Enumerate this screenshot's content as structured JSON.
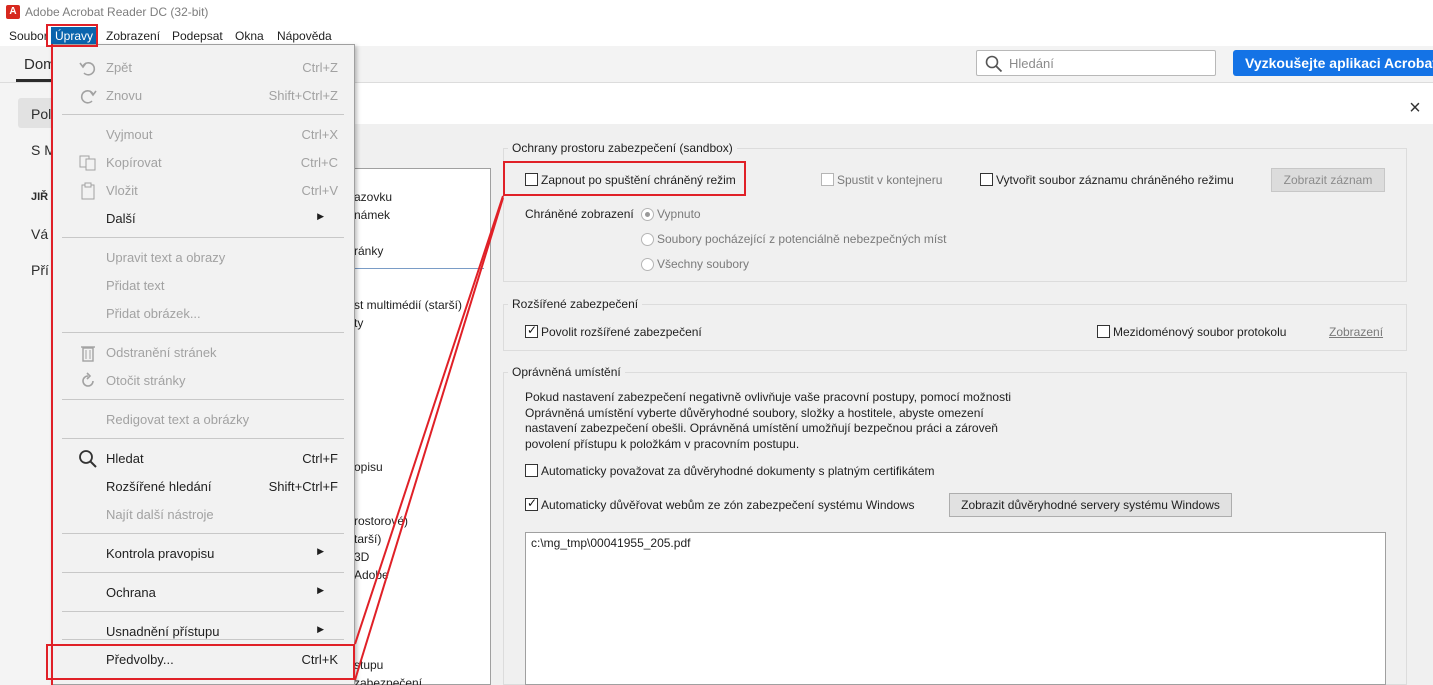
{
  "window": {
    "title": "Adobe Acrobat Reader DC (32-bit)",
    "logo": "A"
  },
  "menubar": {
    "items": [
      "Soubor",
      "Úpravy",
      "Zobrazení",
      "Podepsat",
      "Okna",
      "Nápověda"
    ],
    "active": "Úpravy"
  },
  "toolbar": {
    "tab_label": "Dom",
    "search_placeholder": "Hledání",
    "try_button": "Vyzkoušejte aplikaci Acrobat"
  },
  "left_panel": {
    "items": [
      "Pol",
      "S M",
      "JIŘ",
      "Vá",
      "Pří"
    ]
  },
  "categories_partial": [
    "azovku",
    "námek",
    "ránky",
    "st multimédií (starší)",
    "ty",
    "opisu",
    "rostorové)",
    "tarší)",
    "3D",
    "Adobe",
    "stupu",
    "zabezpečení"
  ],
  "sandbox": {
    "title": "Ochrany prostoru zabezpečení (sandbox)",
    "enable_protected_mode": "Zapnout po spuštění chráněný režim",
    "run_in_container": "Spustit v kontejneru",
    "create_log": "Vytvořit soubor záznamu chráněného režimu",
    "view_log_button": "Zobrazit záznam",
    "protected_view_label": "Chráněné zobrazení",
    "pv_options": [
      "Vypnuto",
      "Soubory pocházející z potenciálně nebezpečných míst",
      "Všechny soubory"
    ],
    "pv_selected": "Vypnuto"
  },
  "enhanced": {
    "title": "Rozšířené zabezpečení",
    "enable": "Povolit rozšířené zabezpečení",
    "cross_domain": "Mezidoménový soubor protokolu",
    "view_link": "Zobrazení"
  },
  "privileged": {
    "title": "Oprávněná umístění",
    "description": [
      "Pokud nastavení zabezpečení negativně ovlivňuje vaše pracovní postupy, pomocí možnosti",
      "Oprávněná umístění vyberte důvěryhodné soubory, složky a hostitele, abyste omezení",
      "nastavení zabezpečení obešli. Oprávněná umístění umožňují bezpečnou práci a zároveň",
      "povolení přístupu k položkám v pracovním postupu."
    ],
    "trust_certified": "Automaticky považovat za důvěryhodné dokumenty s platným certifikátem",
    "trust_windows_zones": "Automaticky důvěřovat webům ze zón zabezpečení systému Windows",
    "show_servers_button": "Zobrazit důvěryhodné servery systému Windows",
    "list_items": [
      "c:\\mg_tmp\\00041955_205.pdf"
    ]
  },
  "dialog": {
    "close": "×"
  },
  "edit_menu": {
    "items": [
      {
        "label": "Zpět",
        "shortcut": "Ctrl+Z",
        "enabled": false,
        "icon": "undo-icon"
      },
      {
        "label": "Znovu",
        "shortcut": "Shift+Ctrl+Z",
        "enabled": false,
        "icon": "redo-icon"
      },
      {
        "sep": true
      },
      {
        "label": "Vyjmout",
        "shortcut": "Ctrl+X",
        "enabled": false,
        "icon": ""
      },
      {
        "label": "Kopírovat",
        "shortcut": "Ctrl+C",
        "enabled": false,
        "icon": "copy-icon"
      },
      {
        "label": "Vložit",
        "shortcut": "Ctrl+V",
        "enabled": false,
        "icon": "paste-icon"
      },
      {
        "label": "Další",
        "shortcut": "",
        "enabled": true,
        "submenu": true,
        "icon": ""
      },
      {
        "sep": true
      },
      {
        "label": "Upravit text a obrazy",
        "shortcut": "",
        "enabled": false,
        "icon": ""
      },
      {
        "label": "Přidat text",
        "shortcut": "",
        "enabled": false,
        "icon": ""
      },
      {
        "label": "Přidat obrázek...",
        "shortcut": "",
        "enabled": false,
        "icon": ""
      },
      {
        "sep": true
      },
      {
        "label": "Odstranění stránek",
        "shortcut": "",
        "enabled": false,
        "icon": "trash-icon"
      },
      {
        "label": "Otočit stránky",
        "shortcut": "",
        "enabled": false,
        "icon": "rotate-icon"
      },
      {
        "sep": true
      },
      {
        "label": "Redigovat text a obrázky",
        "shortcut": "",
        "enabled": false,
        "icon": ""
      },
      {
        "sep": true
      },
      {
        "label": "Hledat",
        "shortcut": "Ctrl+F",
        "enabled": true,
        "icon": "search-icon"
      },
      {
        "label": "Rozšířené hledání",
        "shortcut": "Shift+Ctrl+F",
        "enabled": true,
        "icon": ""
      },
      {
        "label": "Najít další nástroje",
        "shortcut": "",
        "enabled": false,
        "icon": ""
      },
      {
        "sep": true
      },
      {
        "label": "Kontrola pravopisu",
        "shortcut": "",
        "enabled": true,
        "submenu": true,
        "icon": ""
      },
      {
        "sep": true
      },
      {
        "label": "Ochrana",
        "shortcut": "",
        "enabled": true,
        "submenu": true,
        "icon": ""
      },
      {
        "sep": true
      },
      {
        "label": "Usnadnění přístupu",
        "shortcut": "",
        "enabled": true,
        "submenu": true,
        "icon": ""
      },
      {
        "sep": true
      },
      {
        "label": "Předvolby...",
        "shortcut": "Ctrl+K",
        "enabled": true,
        "icon": ""
      }
    ]
  },
  "colors": {
    "accent": "#0a64ad",
    "highlight": "#e02027",
    "brand": "#1473e6"
  }
}
